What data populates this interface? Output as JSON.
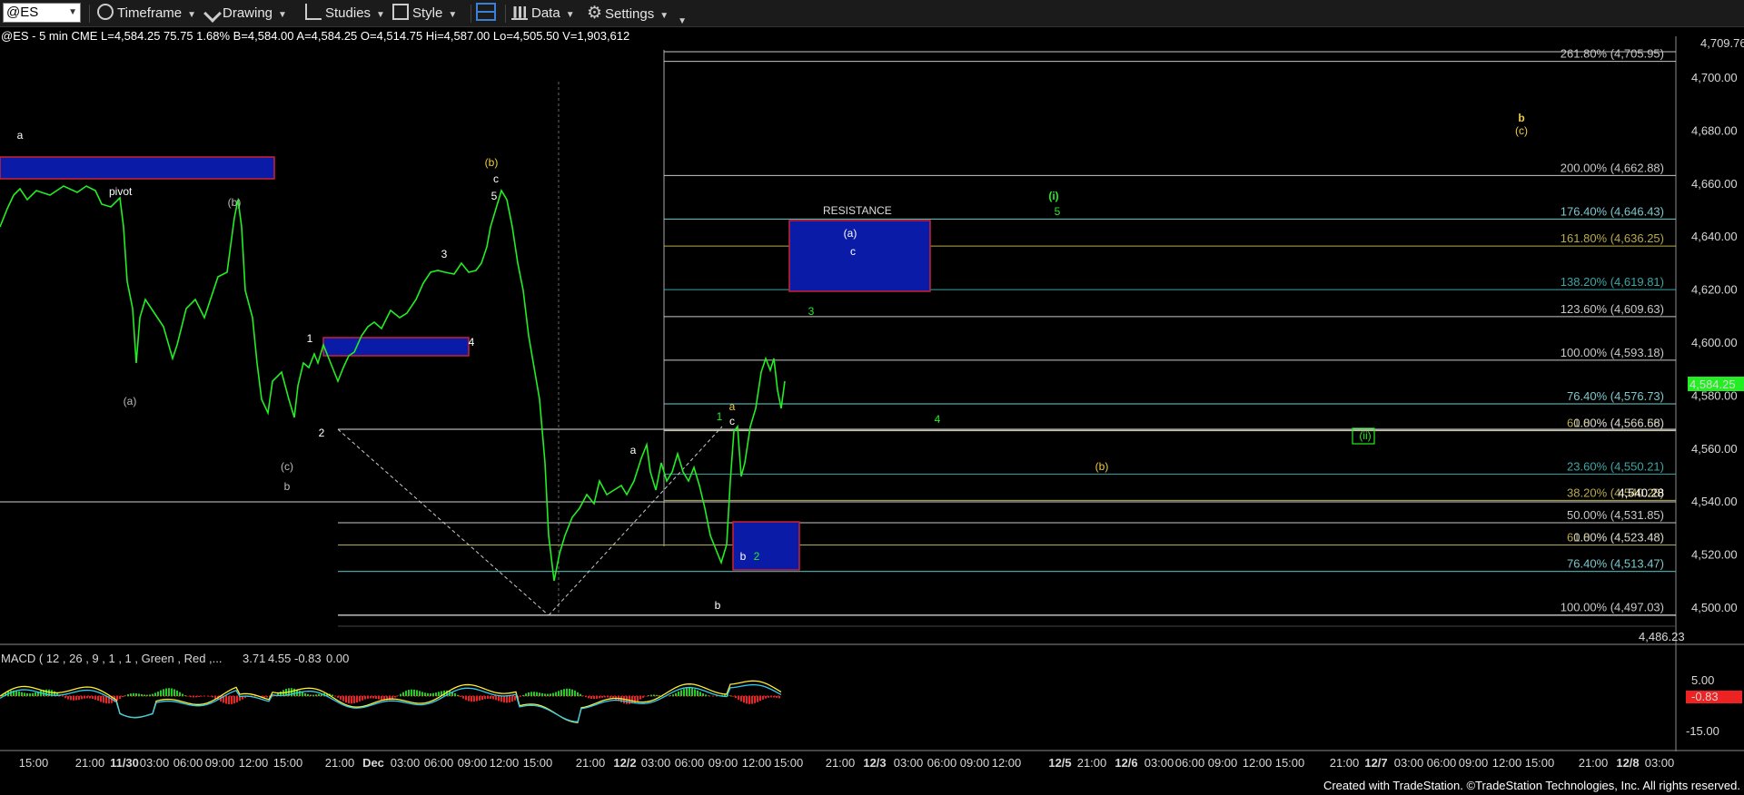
{
  "toolbar": {
    "symbol": "@ES",
    "timeframe": "Timeframe",
    "drawing": "Drawing",
    "studies": "Studies",
    "style": "Style",
    "data": "Data",
    "settings": "Settings"
  },
  "header": {
    "info": "@ES - 5 min  CME   L=4,584.25  75.75  1.68%  B=4,584.00  A=4,584.25  O=4,514.75  Hi=4,587.00  Lo=4,505.50  V=1,903,612"
  },
  "price_axis": {
    "ticks": [
      "4,700.00",
      "4,680.00",
      "4,660.00",
      "4,640.00",
      "4,620.00",
      "4,600.00",
      "4,580.00",
      "4,560.00",
      "4,540.00",
      "4,520.00",
      "4,500.00"
    ],
    "last_price": "4,584.25",
    "low_label": "4,486.23",
    "top_label": "4,709.76"
  },
  "fib_levels": [
    {
      "label": "261.80% (4,705.95)",
      "color": "#c8c8c8",
      "price": 4705.95
    },
    {
      "label": "200.00% (4,662.88)",
      "color": "#c8c8c8",
      "price": 4662.88
    },
    {
      "label": "176.40% (4,646.43)",
      "color": "#7ac8cc",
      "price": 4646.43
    },
    {
      "label": "161.80% (4,636.25)",
      "color": "#b8aa4c",
      "price": 4636.25
    },
    {
      "label": "138.20% (4,619.81)",
      "color": "#3aa6a6",
      "price": 4619.81
    },
    {
      "label": "123.60% (4,609.63)",
      "color": "#c8c8c8",
      "price": 4609.63
    },
    {
      "label": "100.00% (4,593.18)",
      "color": "#c8c8c8",
      "price": 4593.18
    },
    {
      "label": "76.40% (4,576.73)",
      "color": "#7ac8cc",
      "price": 4576.73
    },
    {
      "label": "61.80% (4,566.56)",
      "color": "#b8aa4c",
      "price": 4566.56
    },
    {
      "label": "0.00% (4,566.68)",
      "color": "#c8c8c8",
      "price": 4566.68
    },
    {
      "label": "23.60% (4,550.21)",
      "color": "#3aa6a6",
      "price": 4550.21
    },
    {
      "label": "38.20% (4,540.28)",
      "color": "#b8aa4c",
      "price": 4540.28
    },
    {
      "label": "4,540.28",
      "color": "#ffffff",
      "price": 4540.28
    },
    {
      "label": "50.00% (4,531.85)",
      "color": "#c8c8c8",
      "price": 4531.85
    },
    {
      "label": "61.80% (4,523.48)",
      "color": "#b8aa4c",
      "price": 4523.48
    },
    {
      "label": "0.00% (4,523.48)",
      "color": "#c8c8c8",
      "price": 4523.48
    },
    {
      "label": "76.40% (4,513.47)",
      "color": "#7ac8cc",
      "price": 4513.47
    },
    {
      "label": "100.00% (4,497.03)",
      "color": "#c8c8c8",
      "price": 4497.03
    }
  ],
  "time_axis": [
    "15:00",
    "21:00",
    "11/30",
    "03:00",
    "06:00",
    "09:00",
    "12:00",
    "15:00",
    "21:00",
    "Dec",
    "03:00",
    "06:00",
    "09:00",
    "12:00",
    "15:00",
    "21:00",
    "12/2",
    "03:00",
    "06:00",
    "09:00",
    "12:00",
    "15:00",
    "21:00",
    "12/3",
    "03:00",
    "06:00",
    "09:00",
    "12:00",
    "12/5",
    "21:00",
    "12/6",
    "03:00",
    "06:00",
    "09:00",
    "12:00",
    "15:00",
    "21:00",
    "12/7",
    "03:00",
    "06:00",
    "09:00",
    "12:00",
    "15:00",
    "21:00",
    "12/8",
    "03:00"
  ],
  "annotations": {
    "pivot": "pivot",
    "resistance": "RESISTANCE"
  },
  "waves": {
    "a_left": "a",
    "b_paren": "(b)",
    "a_paren": "(a)",
    "c_paren": "(c)",
    "b1": "b",
    "one": "1",
    "two": "2",
    "three": "3",
    "four": "4",
    "big_b": "(b)",
    "c_top": "c",
    "five": "5",
    "a_mid": "a",
    "a_green": "a",
    "c_green": "c",
    "one_green": "1",
    "b_low": "b",
    "b_box": "b",
    "two_box": "2",
    "a_res": "(a)",
    "c_res": "c",
    "three_green": "3",
    "four_green": "4",
    "i_green": "(i)",
    "five_green": "5",
    "b_yellow": "(b)",
    "ii_green": "(ii)",
    "b_big": "b",
    "c_big": "(c)"
  },
  "macd": {
    "label": "MACD ( 12 , 26 , 9 , 1 , 1 , Green , Red ,...",
    "v1": "3.71",
    "v2": "4.55",
    "v3": "-0.83",
    "v4": "0.00",
    "ticks": [
      "5.00",
      "-15.00"
    ],
    "badge": "-0.83"
  },
  "footer": "Created with TradeStation. ©TradeStation Technologies, Inc. All rights reserved.",
  "colors": {
    "price": "#22ee22",
    "macd": "#ffee33",
    "signal": "#33ccee",
    "hist_pos": "#22cc22",
    "hist_neg": "#ee2222"
  }
}
